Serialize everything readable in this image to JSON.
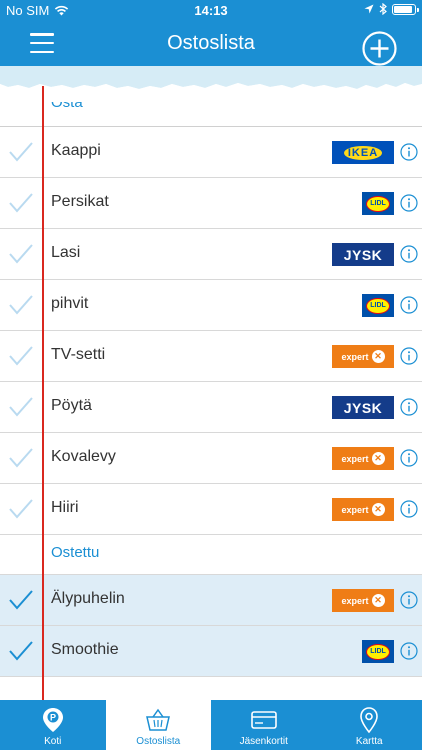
{
  "status": {
    "carrier": "No SIM",
    "time": "14:13"
  },
  "nav": {
    "title": "Ostoslista"
  },
  "sections": {
    "to_buy": "Osta",
    "bought": "Ostettu"
  },
  "to_buy_items": [
    {
      "name": "Kaappi",
      "store": "IKEA"
    },
    {
      "name": "Persikat",
      "store": "LIDL"
    },
    {
      "name": "Lasi",
      "store": "JYSK"
    },
    {
      "name": "pihvit",
      "store": "LIDL"
    },
    {
      "name": "TV-setti",
      "store": "expert"
    },
    {
      "name": "Pöytä",
      "store": "JYSK"
    },
    {
      "name": "Kovalevy",
      "store": "expert"
    },
    {
      "name": "Hiiri",
      "store": "expert"
    }
  ],
  "bought_items": [
    {
      "name": "Älypuhelin",
      "store": "expert"
    },
    {
      "name": "Smoothie",
      "store": "LIDL"
    }
  ],
  "tabs": [
    {
      "label": "Koti",
      "icon": "home-pin-icon"
    },
    {
      "label": "Ostoslista",
      "icon": "basket-icon"
    },
    {
      "label": "Jäsenkortit",
      "icon": "card-icon"
    },
    {
      "label": "Kartta",
      "icon": "map-pin-icon"
    }
  ],
  "colors": {
    "primary": "#1b8fd3",
    "margin_line": "#d9281f",
    "bought_row": "#deedf7",
    "check_light": "#b9daf0",
    "check_dark": "#1b8fd3"
  }
}
